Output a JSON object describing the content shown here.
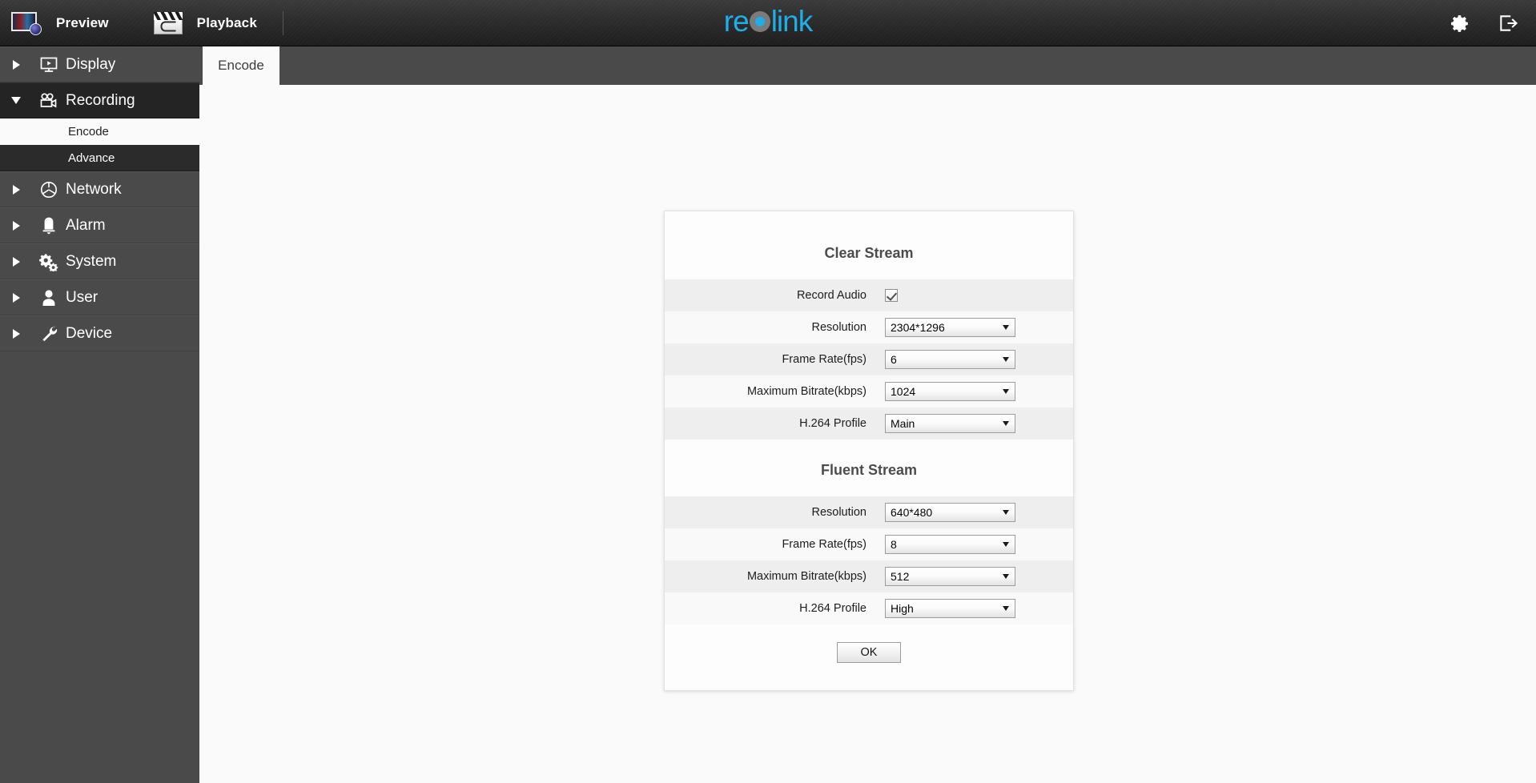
{
  "topbar": {
    "nav": [
      {
        "label": "Preview",
        "icon": "preview-monitor-icon"
      },
      {
        "label": "Playback",
        "icon": "clapperboard-icon"
      }
    ],
    "brand": {
      "pre": "re",
      "post": "link",
      "lens_icon": "camera-lens-icon",
      "accent": "#1eaee8"
    },
    "right_icons": [
      {
        "name": "gear-icon",
        "label": "Settings"
      },
      {
        "name": "logout-icon",
        "label": "Logout"
      }
    ]
  },
  "sidebar": {
    "items": [
      {
        "label": "Display",
        "icon": "monitor-icon",
        "expanded": false
      },
      {
        "label": "Recording",
        "icon": "camcorder-icon",
        "expanded": true
      },
      {
        "label": "Network",
        "icon": "globe-icon",
        "expanded": false
      },
      {
        "label": "Alarm",
        "icon": "bell-icon",
        "expanded": false
      },
      {
        "label": "System",
        "icon": "gears-icon",
        "expanded": false
      },
      {
        "label": "User",
        "icon": "person-icon",
        "expanded": false
      },
      {
        "label": "Device",
        "icon": "wrench-icon",
        "expanded": false
      }
    ],
    "recording_sub": [
      {
        "label": "Encode",
        "active": true
      },
      {
        "label": "Advance",
        "active": false
      }
    ]
  },
  "tabs": [
    {
      "label": "Encode",
      "active": true
    }
  ],
  "dialog": {
    "sections": [
      {
        "title": "Clear Stream",
        "rows": [
          {
            "label": "Record Audio",
            "type": "checkbox",
            "value": "checked"
          },
          {
            "label": "Resolution",
            "type": "select",
            "value": "2304*1296"
          },
          {
            "label": "Frame Rate(fps)",
            "type": "select",
            "value": "6"
          },
          {
            "label": "Maximum Bitrate(kbps)",
            "type": "select",
            "value": "1024"
          },
          {
            "label": "H.264 Profile",
            "type": "select",
            "value": "Main"
          }
        ]
      },
      {
        "title": "Fluent Stream",
        "rows": [
          {
            "label": "Resolution",
            "type": "select",
            "value": "640*480"
          },
          {
            "label": "Frame Rate(fps)",
            "type": "select",
            "value": "8"
          },
          {
            "label": "Maximum Bitrate(kbps)",
            "type": "select",
            "value": "512"
          },
          {
            "label": "H.264 Profile",
            "type": "select",
            "value": "High"
          }
        ]
      }
    ],
    "ok_label": "OK"
  }
}
